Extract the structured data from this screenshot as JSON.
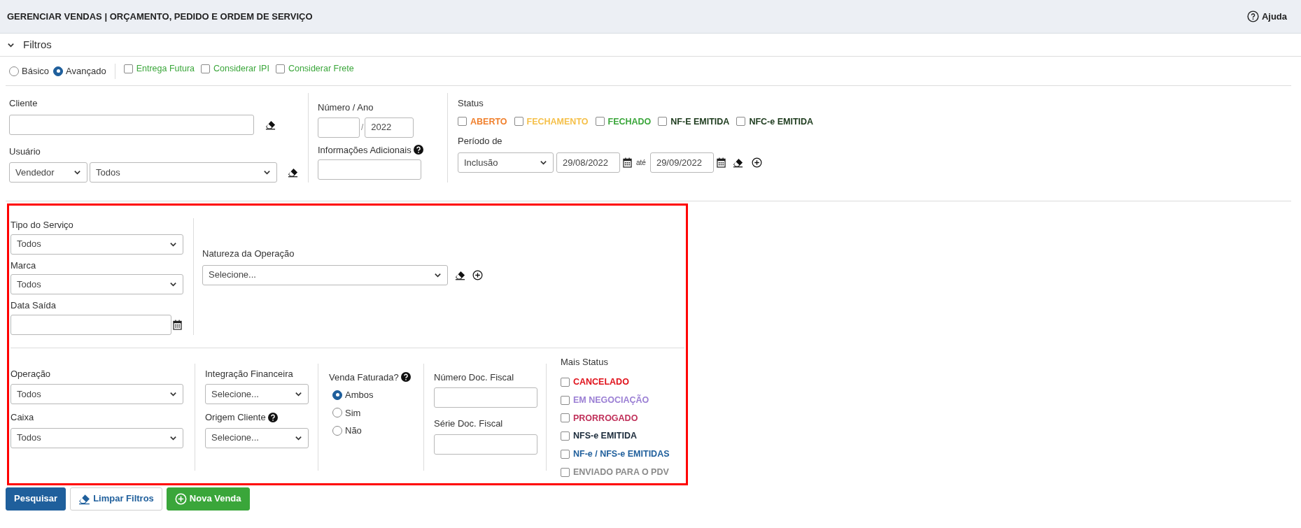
{
  "header": {
    "title": "GERENCIAR VENDAS | ORÇAMENTO, PEDIDO E ORDEM DE SERVIÇO",
    "help": "Ajuda"
  },
  "filters": {
    "label": "Filtros",
    "expanded": true
  },
  "mode": [
    {
      "label": "Básico",
      "selected": false
    },
    {
      "label": "Avançado",
      "selected": true
    }
  ],
  "options": [
    {
      "label": "Entrega Futura",
      "checked": false
    },
    {
      "label": "Considerar IPI",
      "checked": false
    },
    {
      "label": "Considerar Frete",
      "checked": false
    }
  ],
  "cliente": {
    "label": "Cliente"
  },
  "usuario": {
    "label": "Usuário",
    "type": "Vendedor",
    "value": "Todos"
  },
  "numero_ano": {
    "label": "Número / Ano",
    "separator": "/",
    "year": "2022"
  },
  "info_adicionais": {
    "label": "Informações Adicionais"
  },
  "status": {
    "label": "Status",
    "items": [
      {
        "label": "ABERTO",
        "checked": false,
        "color": "#f07f2b"
      },
      {
        "label": "FECHAMENTO",
        "checked": false,
        "color": "#f5c04a"
      },
      {
        "label": "FECHADO",
        "checked": false,
        "color": "#3aa63a"
      },
      {
        "label": "NF-E EMITIDA",
        "checked": false,
        "color": "#1c3a1c"
      },
      {
        "label": "NFC-e EMITIDA",
        "checked": false,
        "color": "#1c3a1c"
      }
    ]
  },
  "periodo": {
    "label": "Período de",
    "type": "Inclusão",
    "from": "29/08/2022",
    "between": "até",
    "to": "29/09/2022"
  },
  "tipo_servico": {
    "label": "Tipo do Serviço",
    "value": "Todos"
  },
  "marca": {
    "label": "Marca",
    "value": "Todos"
  },
  "data_saida": {
    "label": "Data Saída"
  },
  "natureza": {
    "label": "Natureza da Operação",
    "value": "Selecione..."
  },
  "operacao": {
    "label": "Operação",
    "value": "Todos"
  },
  "caixa": {
    "label": "Caixa",
    "value": "Todos"
  },
  "integracao": {
    "label": "Integração Financeira",
    "value": "Selecione..."
  },
  "origem_cliente": {
    "label": "Origem Cliente",
    "value": "Selecione..."
  },
  "venda_faturada": {
    "label": "Venda Faturada?",
    "options": [
      {
        "label": "Ambos",
        "selected": true
      },
      {
        "label": "Sim",
        "selected": false
      },
      {
        "label": "Não",
        "selected": false
      }
    ]
  },
  "numero_doc": {
    "label": "Número Doc. Fiscal"
  },
  "serie_doc": {
    "label": "Série Doc. Fiscal"
  },
  "mais_status": {
    "label": "Mais Status",
    "items": [
      {
        "label": "CANCELADO",
        "checked": false,
        "color": "#e0101a"
      },
      {
        "label": "EM NEGOCIAÇÃO",
        "checked": false,
        "color": "#9b7fd4"
      },
      {
        "label": "PRORROGADO",
        "checked": false,
        "color": "#c0305a"
      },
      {
        "label": "NFS-e EMITIDA",
        "checked": false,
        "color": "#1a2a3a"
      },
      {
        "label": "NF-e / NFS-e EMITIDAS",
        "checked": false,
        "color": "#1f5f9c"
      },
      {
        "label": "ENVIADO PARA O PDV",
        "checked": false,
        "color": "#8a8a8a"
      }
    ]
  },
  "buttons": [
    {
      "label": "Pesquisar",
      "kind": "primary"
    },
    {
      "label": "Limpar Filtros",
      "kind": "clear"
    },
    {
      "label": "Nova Venda",
      "kind": "new"
    }
  ]
}
